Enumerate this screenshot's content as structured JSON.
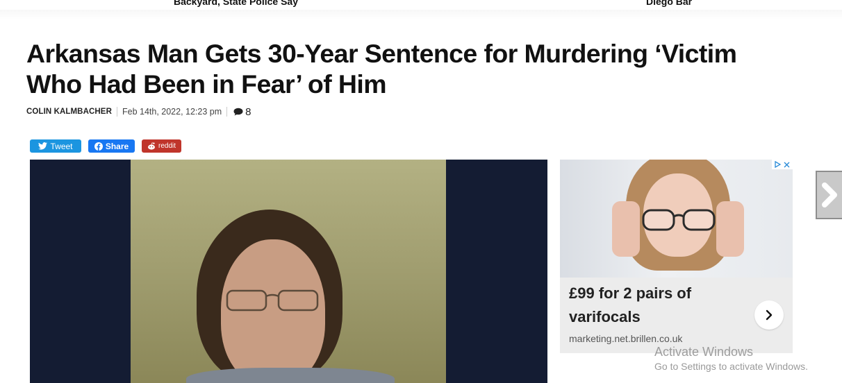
{
  "top_headlines": [
    {
      "text": "Backyard, State Police Say"
    },
    {
      "text": "Diego Bar"
    }
  ],
  "article": {
    "title": "Arkansas Man Gets 30-Year Sentence for Murdering ‘Victim Who Had Been in Fear’ of Him",
    "author": "COLIN KALMBACHER",
    "date": "Feb 14th, 2022, 12:23 pm",
    "comment_count": "8"
  },
  "share": {
    "tweet": "Tweet",
    "facebook": "Share",
    "reddit": "reddit"
  },
  "ad": {
    "headline": "£99 for 2 pairs of varifocals",
    "domain": "marketing.net.brillen.co.uk",
    "adchoices_icon": "adchoices-icon",
    "close_icon": "close-icon"
  },
  "windows_watermark": {
    "title": "Activate Windows",
    "subtitle": "Go to Settings to activate Windows."
  },
  "colors": {
    "twitter": "#1b95e0",
    "facebook": "#1877f2",
    "reddit": "#c0352b",
    "media_background": "#141c33"
  }
}
